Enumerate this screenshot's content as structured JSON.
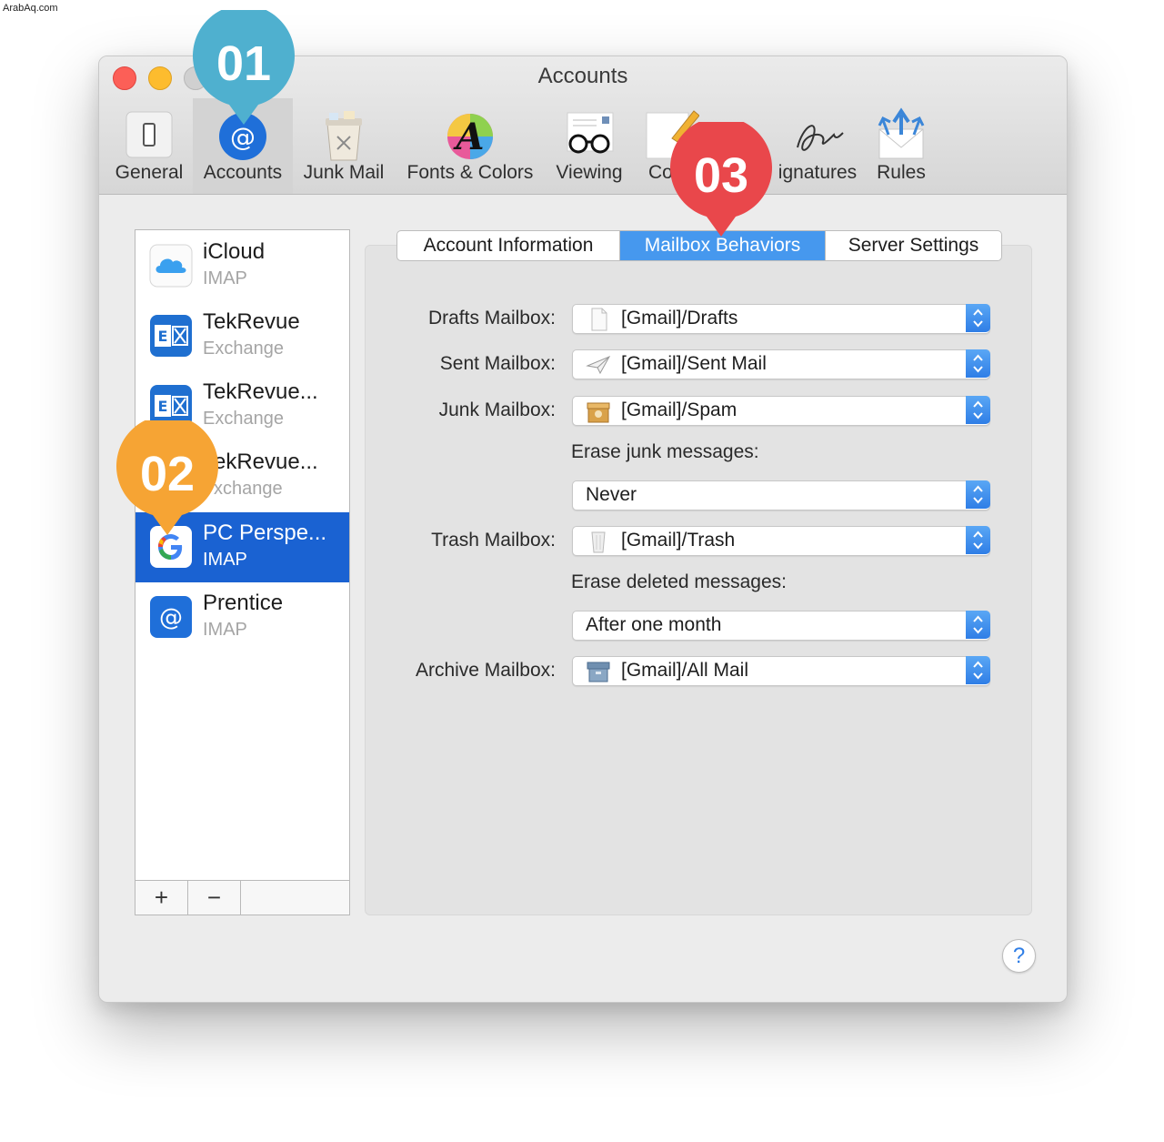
{
  "watermark": "ArabAq.com",
  "window": {
    "title": "Accounts"
  },
  "toolbar": [
    {
      "label": "General",
      "icon": "general-switch-icon"
    },
    {
      "label": "Accounts",
      "icon": "at-sign-icon"
    },
    {
      "label": "Junk Mail",
      "icon": "trash-bin-icon"
    },
    {
      "label": "Fonts & Colors",
      "icon": "font-palette-icon"
    },
    {
      "label": "Viewing",
      "icon": "glasses-icon"
    },
    {
      "label": "Co",
      "icon": "compose-pencil-icon"
    },
    {
      "label": "ignatures",
      "icon": "signature-icon"
    },
    {
      "label": "Rules",
      "icon": "envelope-arrows-icon"
    }
  ],
  "accounts": [
    {
      "name": "iCloud",
      "type": "IMAP",
      "icon": "icloud-icon"
    },
    {
      "name": "TekRevue",
      "type": "Exchange",
      "icon": "exchange-icon"
    },
    {
      "name": "TekRevue...",
      "type": "Exchange",
      "icon": "exchange-icon"
    },
    {
      "name": "ekRevue...",
      "type": "xchange",
      "icon": "exchange-icon"
    },
    {
      "name": "PC Perspe...",
      "type": "IMAP",
      "icon": "google-icon",
      "selected": true
    },
    {
      "name": "Prentice",
      "type": "IMAP",
      "icon": "at-sign-icon"
    }
  ],
  "sidebar_buttons": {
    "add": "+",
    "remove": "−"
  },
  "tabs": [
    "Account Information",
    "Mailbox Behaviors",
    "Server Settings"
  ],
  "selected_tab": "Mailbox Behaviors",
  "form": {
    "drafts": {
      "label": "Drafts Mailbox:",
      "value": "[Gmail]/Drafts",
      "icon": "document-icon"
    },
    "sent": {
      "label": "Sent Mailbox:",
      "value": "[Gmail]/Sent Mail",
      "icon": "paper-plane-icon"
    },
    "junk": {
      "label": "Junk Mailbox:",
      "value": "[Gmail]/Spam",
      "icon": "junk-box-icon"
    },
    "erase_junk": {
      "label": "Erase junk messages:",
      "value": "Never"
    },
    "trash": {
      "label": "Trash Mailbox:",
      "value": "[Gmail]/Trash",
      "icon": "trash-can-icon"
    },
    "erase_deleted": {
      "label": "Erase deleted messages:",
      "value": "After one month"
    },
    "archive": {
      "label": "Archive Mailbox:",
      "value": "[Gmail]/All Mail",
      "icon": "archive-box-icon"
    }
  },
  "help": "?",
  "callouts": [
    {
      "text": "01",
      "color": "#4fb0cf"
    },
    {
      "text": "02",
      "color": "#f6a434"
    },
    {
      "text": "03",
      "color": "#e9474b"
    }
  ]
}
